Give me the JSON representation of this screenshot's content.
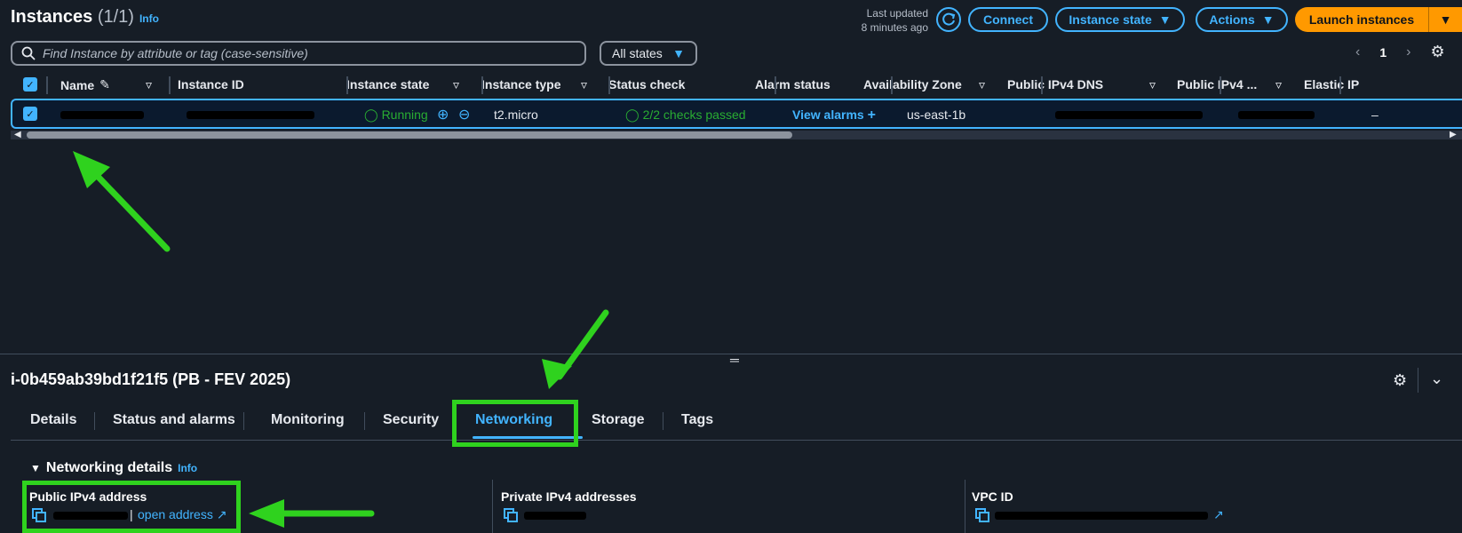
{
  "header": {
    "title": "Instances",
    "count": "(1/1)",
    "info": "Info",
    "last_updated_line1": "Last updated",
    "last_updated_line2": "8 minutes ago",
    "connect": "Connect",
    "instance_state": "Instance state",
    "actions": "Actions",
    "launch": "Launch instances"
  },
  "search": {
    "placeholder": "Find Instance by attribute or tag (case-sensitive)"
  },
  "filter": {
    "selected": "All states"
  },
  "pager": {
    "page": "1"
  },
  "table": {
    "columns": [
      "Name",
      "Instance ID",
      "Instance state",
      "Instance type",
      "Status check",
      "Alarm status",
      "Availability Zone",
      "Public IPv4 DNS",
      "Public IPv4 ...",
      "Elastic IP"
    ],
    "row": {
      "state": "Running",
      "type": "t2.micro",
      "status_check": "2/2 checks passed",
      "alarm": "View alarms",
      "az": "us-east-1b",
      "elastic_ip": "–"
    }
  },
  "detail": {
    "title": "i-0b459ab39bd1f21f5 (PB - FEV 2025)",
    "tabs": [
      "Details",
      "Status and alarms",
      "Monitoring",
      "Security",
      "Networking",
      "Storage",
      "Tags"
    ],
    "section": "Networking details",
    "info": "Info",
    "public_ipv4": "Public IPv4 address",
    "open_address": "open address",
    "private_ipv4": "Private IPv4 addresses",
    "vpc_id": "VPC ID"
  },
  "colors": {
    "accent": "#42b4ff",
    "launch": "#ff9900",
    "annotation": "#2fd21e",
    "running": "#29ad32"
  }
}
